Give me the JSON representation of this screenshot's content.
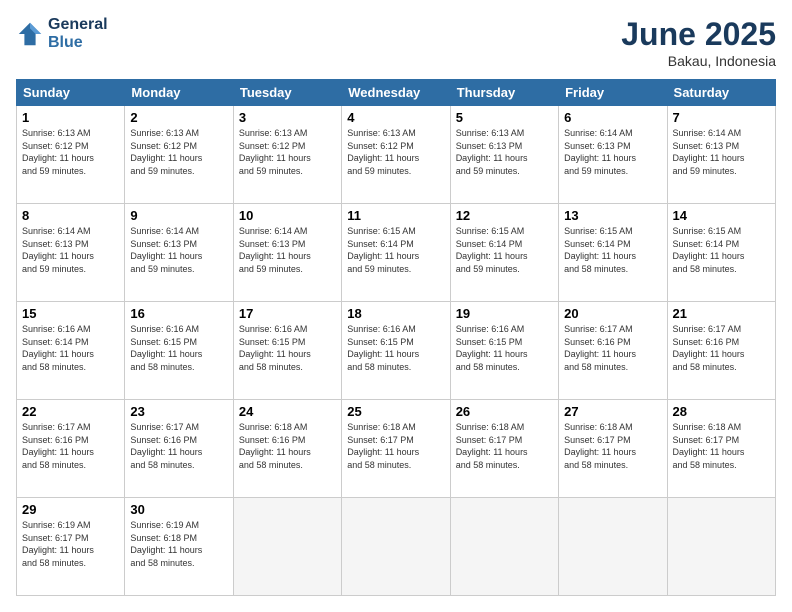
{
  "header": {
    "logo_line1": "General",
    "logo_line2": "Blue",
    "title": "June 2025",
    "subtitle": "Bakau, Indonesia"
  },
  "calendar": {
    "days_of_week": [
      "Sunday",
      "Monday",
      "Tuesday",
      "Wednesday",
      "Thursday",
      "Friday",
      "Saturday"
    ],
    "weeks": [
      [
        {
          "day": "1",
          "info": "Sunrise: 6:13 AM\nSunset: 6:12 PM\nDaylight: 11 hours\nand 59 minutes."
        },
        {
          "day": "2",
          "info": "Sunrise: 6:13 AM\nSunset: 6:12 PM\nDaylight: 11 hours\nand 59 minutes."
        },
        {
          "day": "3",
          "info": "Sunrise: 6:13 AM\nSunset: 6:12 PM\nDaylight: 11 hours\nand 59 minutes."
        },
        {
          "day": "4",
          "info": "Sunrise: 6:13 AM\nSunset: 6:12 PM\nDaylight: 11 hours\nand 59 minutes."
        },
        {
          "day": "5",
          "info": "Sunrise: 6:13 AM\nSunset: 6:13 PM\nDaylight: 11 hours\nand 59 minutes."
        },
        {
          "day": "6",
          "info": "Sunrise: 6:14 AM\nSunset: 6:13 PM\nDaylight: 11 hours\nand 59 minutes."
        },
        {
          "day": "7",
          "info": "Sunrise: 6:14 AM\nSunset: 6:13 PM\nDaylight: 11 hours\nand 59 minutes."
        }
      ],
      [
        {
          "day": "8",
          "info": "Sunrise: 6:14 AM\nSunset: 6:13 PM\nDaylight: 11 hours\nand 59 minutes."
        },
        {
          "day": "9",
          "info": "Sunrise: 6:14 AM\nSunset: 6:13 PM\nDaylight: 11 hours\nand 59 minutes."
        },
        {
          "day": "10",
          "info": "Sunrise: 6:14 AM\nSunset: 6:13 PM\nDaylight: 11 hours\nand 59 minutes."
        },
        {
          "day": "11",
          "info": "Sunrise: 6:15 AM\nSunset: 6:14 PM\nDaylight: 11 hours\nand 59 minutes."
        },
        {
          "day": "12",
          "info": "Sunrise: 6:15 AM\nSunset: 6:14 PM\nDaylight: 11 hours\nand 59 minutes."
        },
        {
          "day": "13",
          "info": "Sunrise: 6:15 AM\nSunset: 6:14 PM\nDaylight: 11 hours\nand 58 minutes."
        },
        {
          "day": "14",
          "info": "Sunrise: 6:15 AM\nSunset: 6:14 PM\nDaylight: 11 hours\nand 58 minutes."
        }
      ],
      [
        {
          "day": "15",
          "info": "Sunrise: 6:16 AM\nSunset: 6:14 PM\nDaylight: 11 hours\nand 58 minutes."
        },
        {
          "day": "16",
          "info": "Sunrise: 6:16 AM\nSunset: 6:15 PM\nDaylight: 11 hours\nand 58 minutes."
        },
        {
          "day": "17",
          "info": "Sunrise: 6:16 AM\nSunset: 6:15 PM\nDaylight: 11 hours\nand 58 minutes."
        },
        {
          "day": "18",
          "info": "Sunrise: 6:16 AM\nSunset: 6:15 PM\nDaylight: 11 hours\nand 58 minutes."
        },
        {
          "day": "19",
          "info": "Sunrise: 6:16 AM\nSunset: 6:15 PM\nDaylight: 11 hours\nand 58 minutes."
        },
        {
          "day": "20",
          "info": "Sunrise: 6:17 AM\nSunset: 6:16 PM\nDaylight: 11 hours\nand 58 minutes."
        },
        {
          "day": "21",
          "info": "Sunrise: 6:17 AM\nSunset: 6:16 PM\nDaylight: 11 hours\nand 58 minutes."
        }
      ],
      [
        {
          "day": "22",
          "info": "Sunrise: 6:17 AM\nSunset: 6:16 PM\nDaylight: 11 hours\nand 58 minutes."
        },
        {
          "day": "23",
          "info": "Sunrise: 6:17 AM\nSunset: 6:16 PM\nDaylight: 11 hours\nand 58 minutes."
        },
        {
          "day": "24",
          "info": "Sunrise: 6:18 AM\nSunset: 6:16 PM\nDaylight: 11 hours\nand 58 minutes."
        },
        {
          "day": "25",
          "info": "Sunrise: 6:18 AM\nSunset: 6:17 PM\nDaylight: 11 hours\nand 58 minutes."
        },
        {
          "day": "26",
          "info": "Sunrise: 6:18 AM\nSunset: 6:17 PM\nDaylight: 11 hours\nand 58 minutes."
        },
        {
          "day": "27",
          "info": "Sunrise: 6:18 AM\nSunset: 6:17 PM\nDaylight: 11 hours\nand 58 minutes."
        },
        {
          "day": "28",
          "info": "Sunrise: 6:18 AM\nSunset: 6:17 PM\nDaylight: 11 hours\nand 58 minutes."
        }
      ],
      [
        {
          "day": "29",
          "info": "Sunrise: 6:19 AM\nSunset: 6:17 PM\nDaylight: 11 hours\nand 58 minutes."
        },
        {
          "day": "30",
          "info": "Sunrise: 6:19 AM\nSunset: 6:18 PM\nDaylight: 11 hours\nand 58 minutes."
        },
        {
          "day": "",
          "info": ""
        },
        {
          "day": "",
          "info": ""
        },
        {
          "day": "",
          "info": ""
        },
        {
          "day": "",
          "info": ""
        },
        {
          "day": "",
          "info": ""
        }
      ]
    ]
  }
}
